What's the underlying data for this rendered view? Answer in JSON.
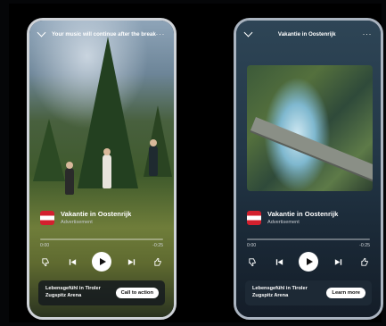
{
  "left_phone": {
    "top_title": "Your music will continue after the break",
    "ad_title": "Vakantie in Oostenrijk",
    "ad_subtitle": "Advertisement",
    "time_elapsed": "0:00",
    "time_remaining": "-0:25",
    "cta_label": "Lebensgefühl in Tiroler Zugspitz Arena",
    "cta_button": "Call to action"
  },
  "right_phone": {
    "top_title": "Vakantie in Oostenrijk",
    "ad_title": "Vakantie in Oostenrijk",
    "ad_subtitle": "Advertisement",
    "time_elapsed": "0:00",
    "time_remaining": "-0:25",
    "cta_label": "Lebensgefühl in Tiroler Zugspitz Arena",
    "cta_button": "Learn more"
  },
  "icons": {
    "collapse": "chevron-down-icon",
    "menu": "more-options-icon",
    "dislike": "thumbs-down-icon",
    "previous": "skip-previous-icon",
    "play": "play-icon",
    "next": "skip-next-icon",
    "like": "thumbs-up-icon",
    "flag": "austria-flag-icon"
  },
  "colors": {
    "flag_red": "#d3202e",
    "button_bg": "#ffffff",
    "right_bg": "#233747"
  }
}
